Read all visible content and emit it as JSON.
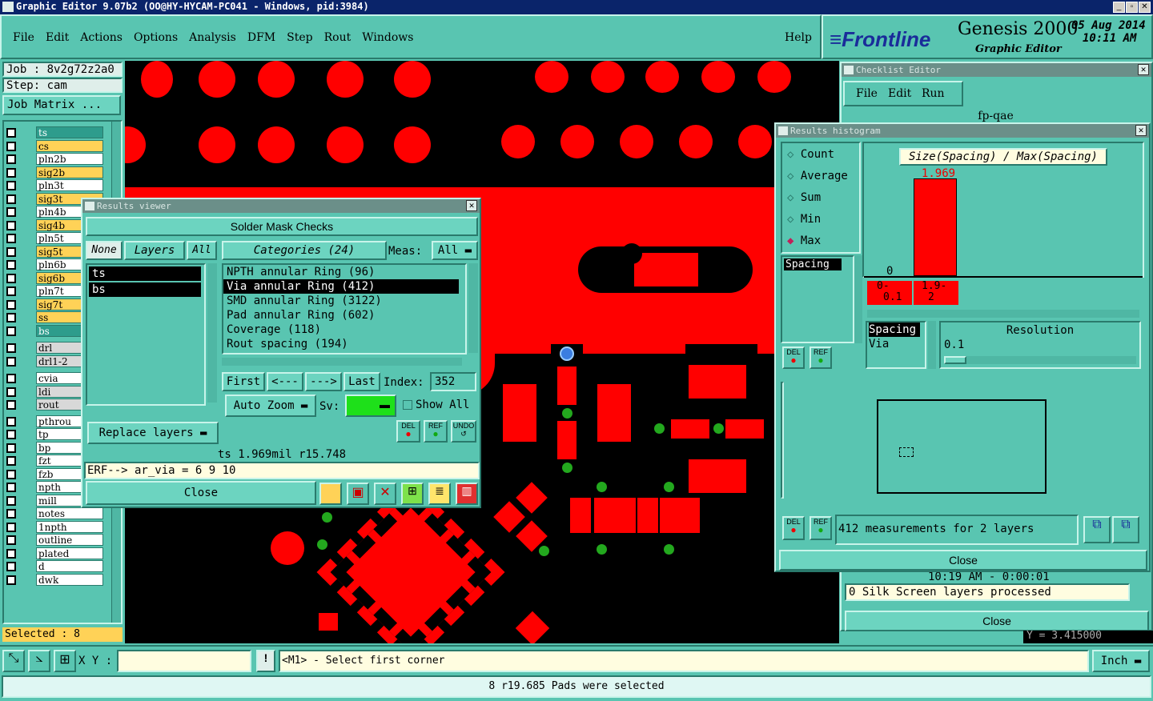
{
  "window": {
    "title": "Graphic Editor 9.07b2 (OO@HY-HYCAM-PC041 - Windows, pid:3984)"
  },
  "menubar": {
    "items": [
      "File",
      "Edit",
      "Actions",
      "Options",
      "Analysis",
      "DFM",
      "Step",
      "Rout",
      "Windows"
    ],
    "help": "Help"
  },
  "brand": {
    "logo": "Frontline",
    "product": "Genesis 2000",
    "subtitle": "Graphic Editor",
    "date": "05 Aug 2014",
    "time": "10:11 AM"
  },
  "job": {
    "job": "Job : 8v2g72z2a0",
    "step": "Step: cam",
    "matrix": "Job Matrix ..."
  },
  "layers": [
    {
      "name": "ts",
      "style": "lg"
    },
    {
      "name": "cs",
      "style": "ly"
    },
    {
      "name": "pln2b",
      "style": "lw"
    },
    {
      "name": "sig2b",
      "style": "ly"
    },
    {
      "name": "pln3t",
      "style": "lw"
    },
    {
      "name": "sig3t",
      "style": "ly"
    },
    {
      "name": "pln4b",
      "style": "lw"
    },
    {
      "name": "sig4b",
      "style": "ly"
    },
    {
      "name": "pln5t",
      "style": "lw"
    },
    {
      "name": "sig5t",
      "style": "ly"
    },
    {
      "name": "pln6b",
      "style": "lw"
    },
    {
      "name": "sig6b",
      "style": "ly"
    },
    {
      "name": "pln7t",
      "style": "lw"
    },
    {
      "name": "sig7t",
      "style": "ly"
    },
    {
      "name": "ss",
      "style": "ly"
    },
    {
      "name": "bs",
      "style": "lg"
    },
    {
      "name": "drl",
      "style": "lgr"
    },
    {
      "name": "drl1-2",
      "style": "lgr"
    },
    {
      "name": "cvia",
      "style": "lw"
    },
    {
      "name": "ldi",
      "style": "lgr"
    },
    {
      "name": "rout",
      "style": "lgr"
    },
    {
      "name": "pthrou",
      "style": "lw"
    },
    {
      "name": "tp",
      "style": "lw"
    },
    {
      "name": "bp",
      "style": "lw"
    },
    {
      "name": "fzt",
      "style": "lw"
    },
    {
      "name": "fzb",
      "style": "lw"
    },
    {
      "name": "npth",
      "style": "lw"
    },
    {
      "name": "mill",
      "style": "lw"
    },
    {
      "name": "notes",
      "style": "lw"
    },
    {
      "name": "1npth",
      "style": "lw"
    },
    {
      "name": "outline",
      "style": "lw"
    },
    {
      "name": "plated",
      "style": "lw"
    },
    {
      "name": "d",
      "style": "lw"
    },
    {
      "name": "dwk",
      "style": "lw"
    }
  ],
  "selected": "Selected : 8",
  "results_viewer": {
    "title": "Results viewer",
    "header": "Solder Mask Checks",
    "none": "None",
    "layers": "Layers",
    "all": "All",
    "categories": "Categories (24)",
    "meas_label": "Meas:",
    "meas_value": "All",
    "layer_list": [
      "ts",
      "bs"
    ],
    "category_list": [
      "NPTH annular Ring (96)",
      "Via annular Ring (412)",
      "SMD annular Ring (3122)",
      "Pad annular Ring (602)",
      "Coverage (118)",
      "Rout spacing (194)"
    ],
    "first": "First",
    "prev": "<---",
    "next": "--->",
    "last": "Last",
    "index_label": "Index:",
    "index_value": "352",
    "auto_zoom": "Auto Zoom",
    "sv": "Sv:",
    "show_all": "Show All",
    "replace": "Replace layers",
    "del": "DEL",
    "ref": "REF",
    "undo": "UNDO",
    "status": "ts 1.969mil  r15.748",
    "erf": "ERF--> ar_via = 6 9 10",
    "close": "Close"
  },
  "checklist": {
    "title": "Checklist Editor",
    "menu": [
      "File",
      "Edit",
      "Run"
    ],
    "name": "fp-qae",
    "time": "10:19 AM - 0:00:01",
    "log": "0 Silk Screen layers processed",
    "close": "Close",
    "coord": "Y = 3.415000"
  },
  "histogram": {
    "title": "Results histogram",
    "options": [
      "Count",
      "Average",
      "Sum",
      "Min",
      "Max"
    ],
    "selected_option": "Max",
    "chart_title": "Size(Spacing) / Max(Spacing)",
    "bins": [
      "0-\n0.1",
      "1.9-\n2"
    ],
    "bin_a": "0-",
    "bin_a2": "0.1",
    "bin_b": "1.9-",
    "bin_b2": "2",
    "zero": "0",
    "value_label": "1.969",
    "list_top": "Spacing",
    "list2": [
      "Spacing",
      "Via"
    ],
    "resolution_label": "Resolution",
    "resolution_value": "0.1",
    "del": "DEL",
    "ref": "REF",
    "measurements": "412 measurements for 2 layers",
    "close": "Close"
  },
  "chart_data": {
    "type": "bar",
    "title": "Size(Spacing) / Max(Spacing)",
    "categories": [
      "0-0.1",
      "1.9-2"
    ],
    "values": [
      0,
      1.969
    ]
  },
  "bottom": {
    "xy_label": "X Y :",
    "xy_value": "",
    "prompt": "<M1> - Select first corner",
    "units": "Inch",
    "status": "8 r19.685 Pads were selected"
  }
}
